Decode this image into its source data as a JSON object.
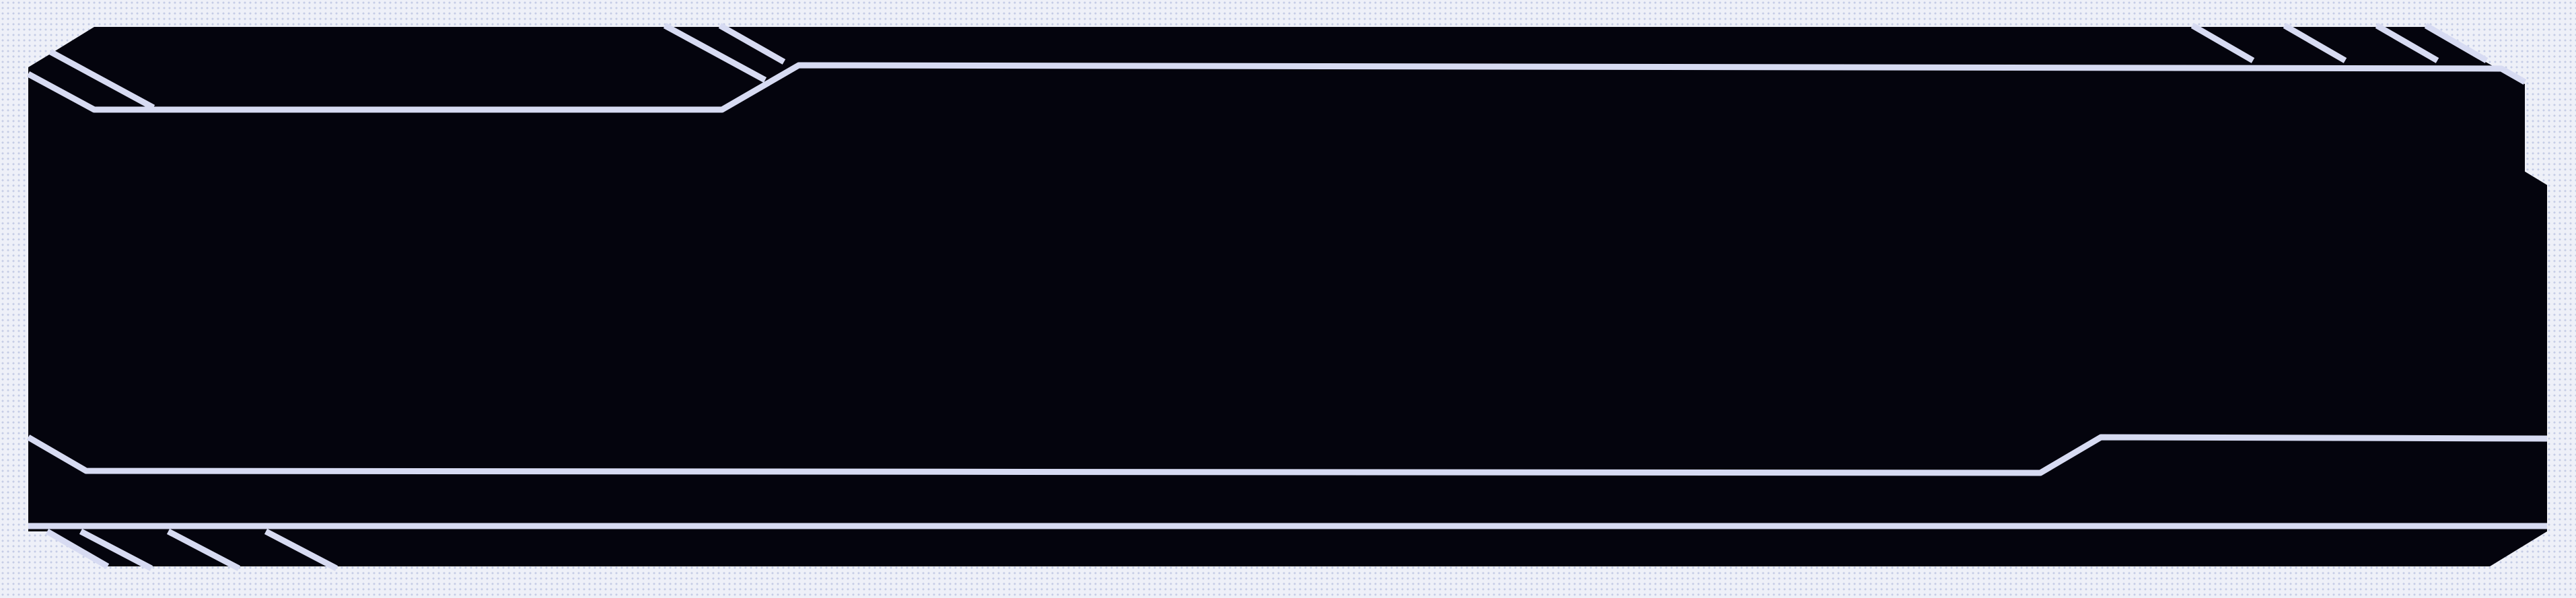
{
  "frame": {
    "panel_color": "#04040d",
    "stroke_color": "#d7dbf2",
    "background_color": "#eef0f8",
    "dot_color": "#c5cce6"
  }
}
